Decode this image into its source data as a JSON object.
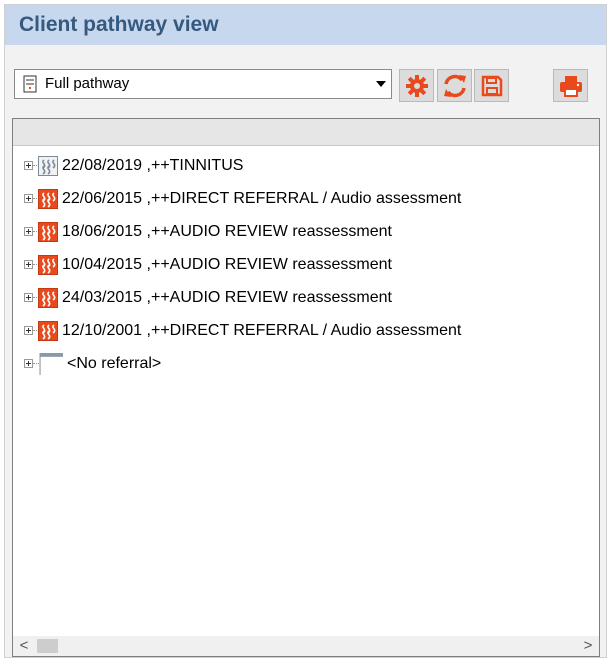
{
  "panel": {
    "title": "Client pathway view"
  },
  "toolbar": {
    "view_select": {
      "selected": "Full pathway"
    },
    "buttons": [
      {
        "icon": "gear-icon"
      },
      {
        "icon": "refresh-icon"
      },
      {
        "icon": "save-icon"
      },
      {
        "icon": "print-icon"
      }
    ]
  },
  "tree": {
    "items": [
      {
        "label": "22/08/2019 ,++TINNITUS",
        "icon": "referral-icon",
        "icon_state": "inactive"
      },
      {
        "label": "22/06/2015 ,++DIRECT REFERRAL / Audio assessment",
        "icon": "referral-icon",
        "icon_state": "active"
      },
      {
        "label": "18/06/2015 ,++AUDIO REVIEW reassessment",
        "icon": "referral-icon",
        "icon_state": "active"
      },
      {
        "label": "10/04/2015 ,++AUDIO REVIEW reassessment",
        "icon": "referral-icon",
        "icon_state": "active"
      },
      {
        "label": "24/03/2015 ,++AUDIO REVIEW reassessment",
        "icon": "referral-icon",
        "icon_state": "active"
      },
      {
        "label": "12/10/2001 ,++DIRECT REFERRAL / Audio assessment",
        "icon": "referral-icon",
        "icon_state": "active"
      },
      {
        "label": "<No referral>",
        "icon": "empty-referral-icon",
        "icon_state": "empty"
      }
    ]
  },
  "scrollbar": {
    "left_arrow": "<",
    "right_arrow": ">"
  },
  "colors": {
    "title_bar": "#c7d8ee",
    "title_text": "#36597f",
    "accent": "#e8491d"
  }
}
